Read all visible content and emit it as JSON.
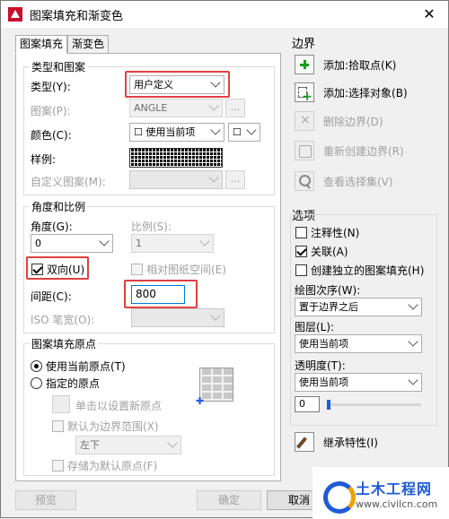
{
  "window": {
    "title": "图案填充和渐变色"
  },
  "tabs": [
    {
      "label": "图案填充"
    },
    {
      "label": "渐变色"
    }
  ],
  "type_group": {
    "legend": "类型和图案",
    "type_label": "类型(Y):",
    "type_value": "用户定义",
    "pattern_label": "图案(P):",
    "pattern_value": "ANGLE",
    "color_label": "颜色(C):",
    "color_value": "☐ 使用当前项",
    "color_bg_value": "☐",
    "sample_label": "样例:",
    "custom_label": "自定义图案(M):",
    "dots": "..."
  },
  "angle_group": {
    "legend": "角度和比例",
    "angle_label": "角度(G):",
    "angle_value": "0",
    "scale_label": "比例(S):",
    "scale_value": "1",
    "double_label": "双向(U)",
    "relative_label": "相对图纸空间(E)",
    "spacing_label": "间距(C):",
    "spacing_value": "800",
    "iso_label": "ISO 笔宽(O):"
  },
  "origin_group": {
    "legend": "图案填充原点",
    "use_current": "使用当前原点(T)",
    "specified": "指定的原点",
    "click_set": "单击以设置新原点",
    "default_extent": "默认为边界范围(X)",
    "extent_value": "左下",
    "store_default": "存储为默认原点(F)"
  },
  "boundary": {
    "legend": "边界",
    "add_pick": "添加:拾取点(K)",
    "add_select": "添加:选择对象(B)",
    "remove": "删除边界(D)",
    "recreate": "重新创建边界(R)",
    "view_sel": "查看选择集(V)"
  },
  "options": {
    "legend": "选项",
    "annotative": "注释性(N)",
    "associative": "关联(A)",
    "separate": "创建独立的图案填充(H)",
    "draw_order_label": "绘图次序(W):",
    "draw_order_value": "置于边界之后",
    "layer_label": "图层(L):",
    "layer_value": "使用当前项",
    "transparency_label": "透明度(T):",
    "transparency_value": "使用当前项",
    "transparency_amount": "0"
  },
  "inherit": "继承特性(I)",
  "buttons": {
    "preview": "预览",
    "ok": "确定",
    "cancel": "取消"
  },
  "watermark": {
    "title": "土木工程网",
    "url": "www.civilcn.com"
  },
  "colors": {
    "highlight": "#e04040",
    "accent": "#1e5bd6"
  }
}
